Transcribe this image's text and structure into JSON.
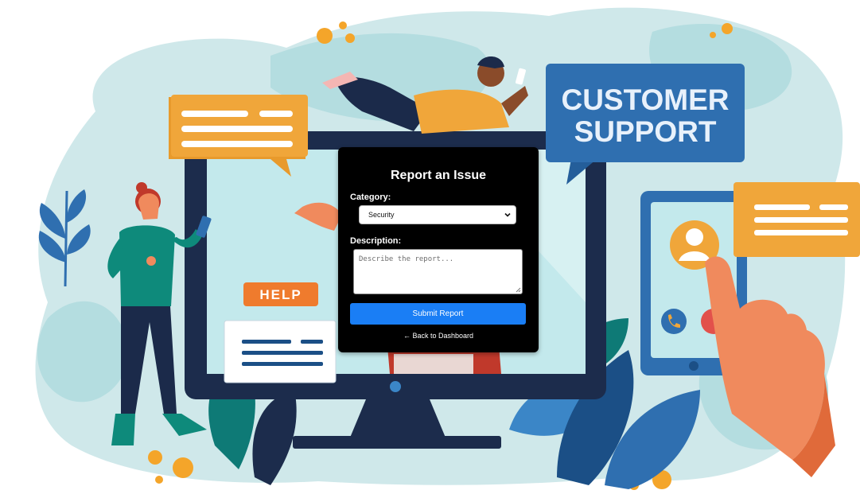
{
  "illustration": {
    "banner_line1": "CUSTOMER",
    "banner_line2": "SUPPORT",
    "help_label": "HELP"
  },
  "form": {
    "title": "Report an Issue",
    "category_label": "Category:",
    "category_value": "Security",
    "description_label": "Description:",
    "description_placeholder": "Describe the report...",
    "submit_label": "Submit Report",
    "back_link": "← Back to Dashboard"
  },
  "colors": {
    "card_bg": "#000000",
    "submit_button": "#1a7ef5",
    "banner_blue": "#2f6fb0",
    "accent_orange": "#f0a63a"
  },
  "icons": [
    "chevron-down-icon",
    "resize-grip-icon",
    "phone-icon",
    "hangup-icon",
    "user-icon"
  ]
}
